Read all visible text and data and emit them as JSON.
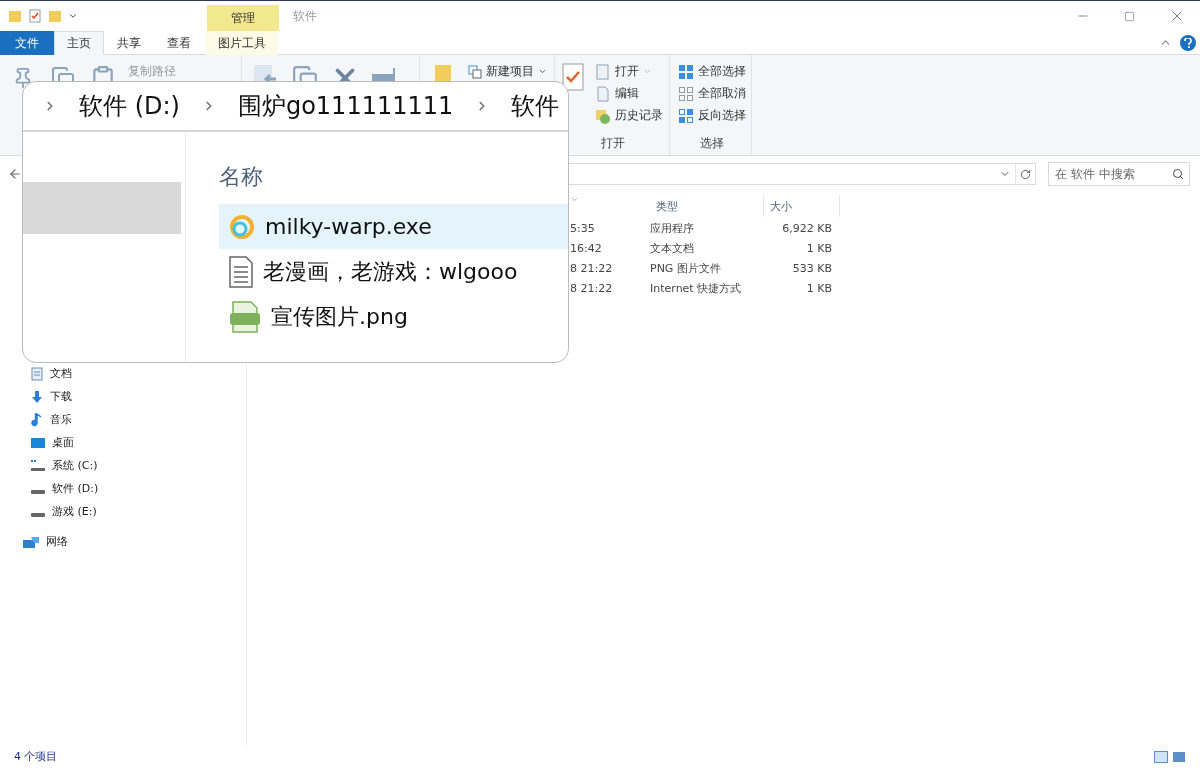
{
  "title_bar": {
    "context_tab": "管理",
    "title": "软件"
  },
  "ribbon_tabs": [
    {
      "label": "文件",
      "kind": "file",
      "selected": false
    },
    {
      "label": "主页",
      "kind": "tab",
      "selected": true
    },
    {
      "label": "共享",
      "kind": "tab",
      "selected": false
    },
    {
      "label": "查看",
      "kind": "tab",
      "selected": false
    },
    {
      "label": "图片工具",
      "kind": "context",
      "selected": false
    }
  ],
  "ribbon": {
    "clipboard": {
      "items": [
        "复制路径"
      ]
    },
    "new": {
      "items": [
        {
          "label": "新建项目",
          "dropdown": true
        }
      ]
    },
    "open": {
      "label": "打开",
      "items": [
        {
          "label": "打开",
          "dropdown": true
        },
        {
          "label": "编辑",
          "dropdown": false
        },
        {
          "label": "历史记录",
          "dropdown": false
        }
      ]
    },
    "select": {
      "label": "选择",
      "items": [
        "全部选择",
        "全部取消",
        "反向选择"
      ]
    }
  },
  "search": {
    "placeholder": "在 软件 中搜索"
  },
  "navigation": [
    {
      "label": "文档",
      "kind": "documents"
    },
    {
      "label": "下载",
      "kind": "downloads"
    },
    {
      "label": "音乐",
      "kind": "music"
    },
    {
      "label": "桌面",
      "kind": "desktop"
    },
    {
      "label": "系统 (C:)",
      "kind": "system-drive"
    },
    {
      "label": "软件 (D:)",
      "kind": "drive"
    },
    {
      "label": "游戏 (E:)",
      "kind": "drive"
    },
    {
      "label": "网络",
      "kind": "network"
    }
  ],
  "file_list": {
    "columns": [
      "类型",
      "大小"
    ],
    "rows": [
      {
        "column_1": "5:35",
        "type": "应用程序",
        "size": "6,922 KB"
      },
      {
        "column_1": "16:42",
        "type": "文本文档",
        "size": "1 KB"
      },
      {
        "column_1": "8 21:22",
        "type": "PNG 图片文件",
        "size": "533 KB"
      },
      {
        "column_1": "8 21:22",
        "type": "Internet 快捷方式",
        "size": "1 KB"
      }
    ]
  },
  "status_bar": {
    "count": "4 个项目"
  },
  "magnifier": {
    "breadcrumb": [
      "软件 (D:)",
      "围炉go111111111",
      "软件"
    ],
    "column": "名称",
    "rows": [
      {
        "name": "milky-warp.exe",
        "kind": "exe",
        "selected": true
      },
      {
        "name": "老漫画，老游戏：wlgooo",
        "kind": "text",
        "selected": false
      },
      {
        "name": "宣传图片.png",
        "kind": "png",
        "selected": false
      }
    ]
  }
}
